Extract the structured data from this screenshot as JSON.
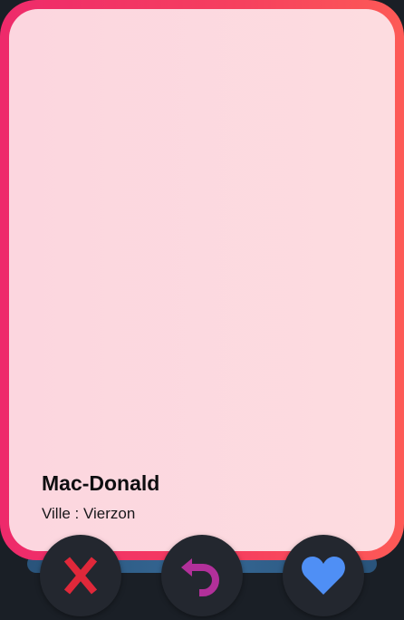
{
  "card": {
    "name": "Mac-Donald",
    "city_line": "Ville : Vierzon"
  },
  "actions": {
    "reject": {
      "icon": "close-icon",
      "color": "#e0283a"
    },
    "undo": {
      "icon": "undo-icon",
      "color": "#b2309a"
    },
    "like": {
      "icon": "heart-icon",
      "color": "#4f8ff5"
    }
  },
  "colors": {
    "background": "#1a1f26",
    "card_border_start": "#ee2a6b",
    "card_border_end": "#fd5a56",
    "card_fill": "#fcd6df",
    "button_bg": "#23272f"
  }
}
